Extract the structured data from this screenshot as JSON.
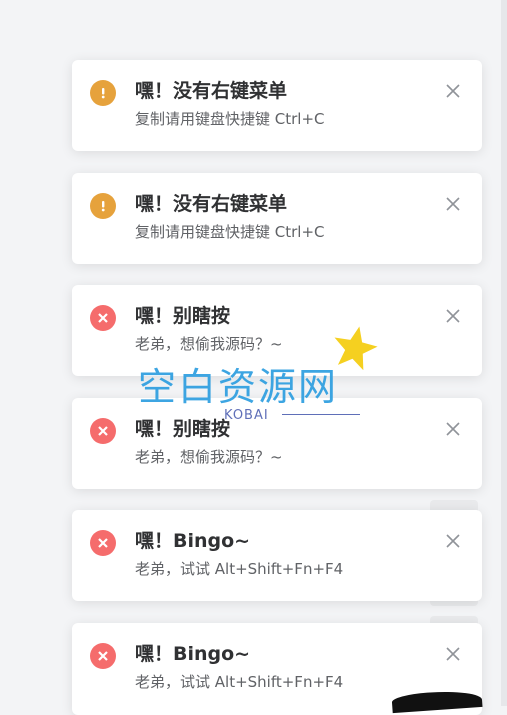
{
  "notifications": [
    {
      "type": "warning",
      "title": "嘿！没有右键菜单",
      "message": "复制请用键盘快捷键 Ctrl+C"
    },
    {
      "type": "warning",
      "title": "嘿！没有右键菜单",
      "message": "复制请用键盘快捷键 Ctrl+C"
    },
    {
      "type": "error",
      "title": "嘿！别瞎按",
      "message": "老弟，想偷我源码？~"
    },
    {
      "type": "error",
      "title": "嘿！别瞎按",
      "message": "老弟，想偷我源码？~"
    },
    {
      "type": "error",
      "title": "嘿！Bingo~",
      "message": "老弟，试试 Alt+Shift+Fn+F4"
    },
    {
      "type": "error",
      "title": "嘿！Bingo~",
      "message": "老弟，试试 Alt+Shift+Fn+F4"
    }
  ],
  "watermark": {
    "title": "空白资源网",
    "subtitle": "KOBAI"
  },
  "colors": {
    "warning": "#e6a23c",
    "error": "#f56c6c",
    "watermark": "#2d9ee0"
  },
  "icons": {
    "warning": "exclamation-icon",
    "error": "x-icon",
    "close": "close-icon"
  }
}
